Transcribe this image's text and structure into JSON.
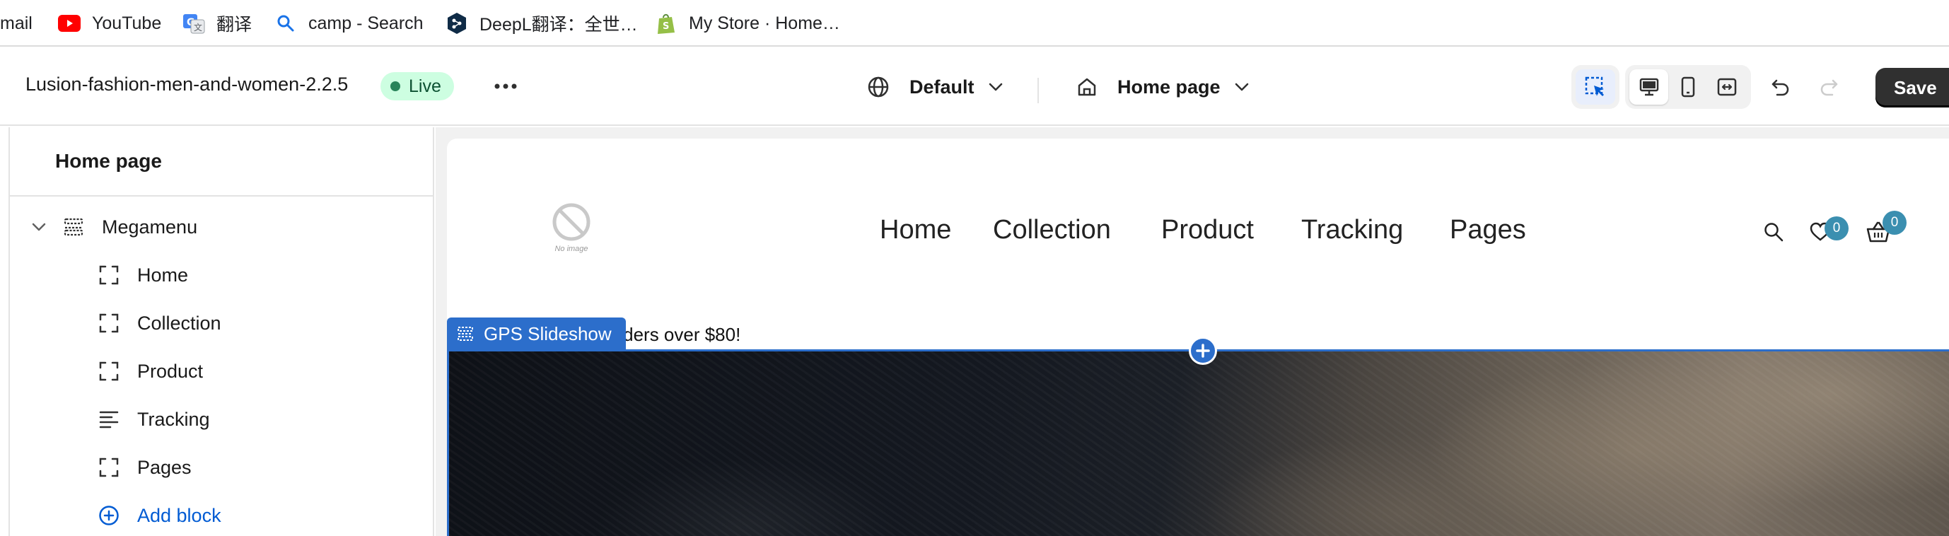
{
  "bookmarks": [
    {
      "label": "mail",
      "icon": "mail-icon"
    },
    {
      "label": "YouTube",
      "icon": "youtube-icon"
    },
    {
      "label": "翻译",
      "icon": "translate-icon"
    },
    {
      "label": "camp - Search",
      "icon": "search-icon"
    },
    {
      "label": "DeepL翻译：全世…",
      "icon": "deepl-icon"
    },
    {
      "label": "My Store · Home…",
      "icon": "shopify-icon"
    }
  ],
  "topbar": {
    "theme_name": "Lusion-fashion-men-and-women-2.2.5",
    "live_label": "Live",
    "template_label": "Default",
    "page_label": "Home page",
    "save_label": "Save"
  },
  "sidebar": {
    "title": "Home page",
    "section_label": "Megamenu",
    "blocks": [
      {
        "label": "Home",
        "icon": "block-icon"
      },
      {
        "label": "Collection",
        "icon": "block-icon"
      },
      {
        "label": "Product",
        "icon": "block-icon"
      },
      {
        "label": "Tracking",
        "icon": "text-lines-icon"
      },
      {
        "label": "Pages",
        "icon": "block-icon"
      }
    ],
    "add_block_label": "Add block"
  },
  "preview": {
    "no_image_label": "No image",
    "nav": [
      "Home",
      "Collection",
      "Product",
      "Tracking",
      "Pages"
    ],
    "wishlist_count": "0",
    "cart_count": "0",
    "announcement": "orders over $80!",
    "section_tag": "GPS Slideshow"
  },
  "colors": {
    "accent": "#2c6ecb",
    "live_bg": "#cdfee1",
    "badge": "#3b8fb0",
    "save_bg": "#303030"
  }
}
